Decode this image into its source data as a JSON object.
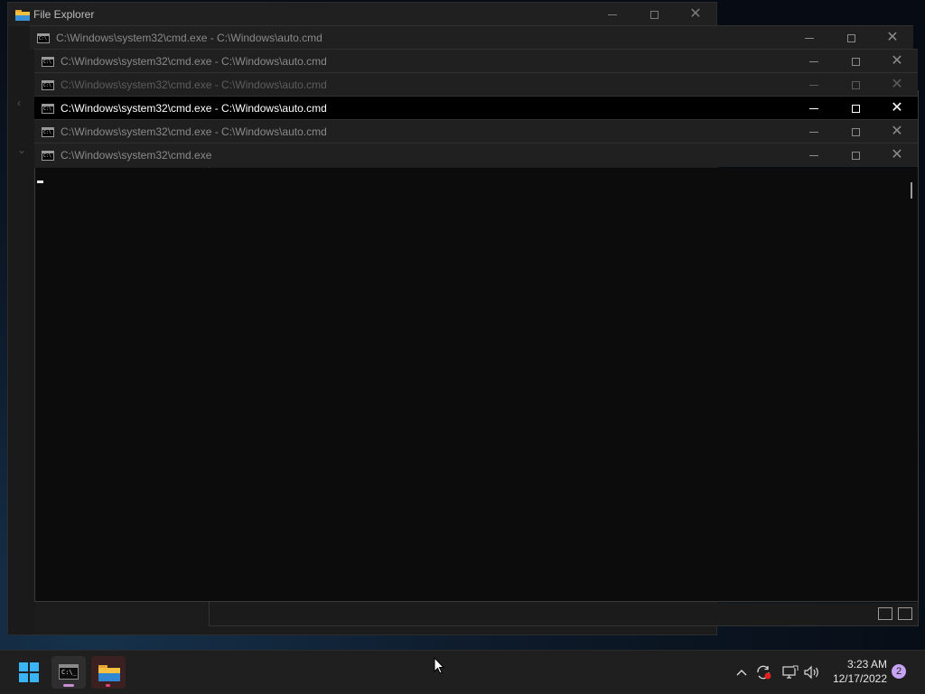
{
  "explorer": {
    "title": "File Explorer"
  },
  "cmd_windows": [
    {
      "title": "C:\\Windows\\system32\\cmd.exe - C:\\Windows\\auto.cmd",
      "state": "inactive"
    },
    {
      "title": "C:\\Windows\\system32\\cmd.exe - C:\\Windows\\auto.cmd",
      "state": "inactive"
    },
    {
      "title": "C:\\Windows\\system32\\cmd.exe - C:\\Windows\\auto.cmd",
      "state": "faded"
    },
    {
      "title": "C:\\Windows\\system32\\cmd.exe - C:\\Windows\\auto.cmd",
      "state": "active"
    },
    {
      "title": "C:\\Windows\\system32\\cmd.exe - C:\\Windows\\auto.cmd",
      "state": "inactive"
    },
    {
      "title": "C:\\Windows\\system32\\cmd.exe",
      "state": "inactive"
    }
  ],
  "window_controls": {
    "minimize": "minimize-icon",
    "maximize": "maximize-icon",
    "close": "close-icon"
  },
  "taskbar": {
    "start": "windows-start-icon",
    "pinned": [
      "terminal-icon",
      "folder-icon"
    ],
    "tray": {
      "chevron": "chevron-up-icon",
      "sync": "sync-icon",
      "network": "network-icon",
      "volume": "volume-icon"
    },
    "clock": {
      "time": "3:23 AM",
      "date": "12/17/2022"
    },
    "notification_count": "2"
  },
  "colors": {
    "accent": "#3ab4f2",
    "active_title_bg": "#000000",
    "console_bg": "#0c0c0c"
  }
}
